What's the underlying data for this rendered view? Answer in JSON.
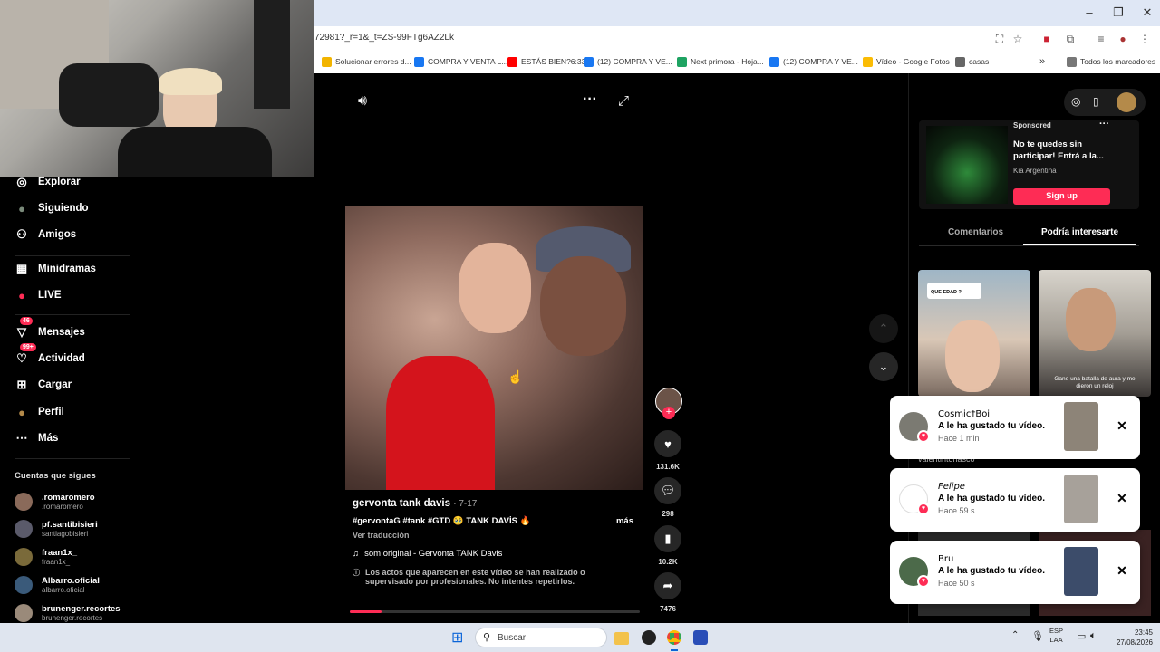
{
  "browser": {
    "url": "72981?_r=1&_t=ZS-99FTg6AZ2Lk",
    "window_buttons": [
      "–",
      "❐",
      "✕"
    ],
    "bookmarks": [
      {
        "label": "Solucionar errores d...",
        "color": "#f2b400"
      },
      {
        "label": "COMPRA Y VENTA L...",
        "color": "#1877f2"
      },
      {
        "label": "ESTÁS BIEN?6:33",
        "color": "#ff0000"
      },
      {
        "label": "(12) COMPRA Y VE...",
        "color": "#1877f2"
      },
      {
        "label": "Next primora - Hoja...",
        "color": "#1ea362"
      },
      {
        "label": "(12) COMPRA Y VE...",
        "color": "#1877f2"
      },
      {
        "label": "Vídeo - Google Fotos",
        "color": "#fbbc04"
      },
      {
        "label": "casas",
        "color": "#666666"
      }
    ],
    "all_bookmarks": "Todos los marcadores"
  },
  "sidebar": {
    "nav": [
      {
        "label": "Explorar",
        "icon": "compass-icon",
        "glyph": "◎"
      },
      {
        "label": "Siguiendo",
        "icon": "following-avatar-icon",
        "glyph": "●"
      },
      {
        "label": "Amigos",
        "icon": "friends-icon",
        "glyph": "⚇"
      },
      {
        "label": "Minidramas",
        "icon": "film-icon",
        "glyph": "▦"
      },
      {
        "label": "LIVE",
        "icon": "live-icon",
        "glyph": "●"
      },
      {
        "label": "Mensajes",
        "icon": "messages-icon",
        "glyph": "▽",
        "badge": "46"
      },
      {
        "label": "Actividad",
        "icon": "activity-icon",
        "glyph": "♡",
        "badge": "99+"
      },
      {
        "label": "Cargar",
        "icon": "upload-icon",
        "glyph": "⊞"
      },
      {
        "label": "Perfil",
        "icon": "profile-avatar-icon",
        "glyph": "●"
      },
      {
        "label": "Más",
        "icon": "more-icon",
        "glyph": "⋯"
      }
    ],
    "following_heading": "Cuentas que sigues",
    "following": [
      {
        "name": ".romaromero",
        "handle": ".romaromero"
      },
      {
        "name": "pf.santibisieri",
        "handle": "santiagobisieri"
      },
      {
        "name": "fraan1x_",
        "handle": "fraan1x_"
      },
      {
        "name": "Albarro.oficial",
        "handle": "albarro.oficial"
      },
      {
        "name": "brunenger.recortes",
        "handle": "brunenger.recortes"
      }
    ]
  },
  "video": {
    "author": "gervonta tank davis",
    "date": "· 7-17",
    "caption": "#gervontaG #tank #GTD 🥹 TANK DAVİS 🔥",
    "more": "más",
    "translate": "Ver traducción",
    "sound": "som original - Gervonta TANK Davis",
    "disclaimer": "Los actos que aparecen en este vídeo se han realizado o supervisado por profesionales. No intentes repetirlos.",
    "likes": "131.6K",
    "comments": "298",
    "saves": "10.2K",
    "shares": "7476",
    "progress": 0.11
  },
  "right_panel": {
    "ad": {
      "label": "Sponsored",
      "title": "No te quedes sin participar! Entrá a la...",
      "advertiser": "Kia Argentina",
      "cta": "Sign up"
    },
    "tabs": [
      "Comentarios",
      "Podría interesarte"
    ],
    "thumb_texts": [
      "QUE EDAD ?",
      "Gane una batalla de aura y me dieron un reloj"
    ],
    "behind_text": "valentintonasco"
  },
  "notifications": [
    {
      "user": "Cosmic†Boi",
      "text": "A le ha gustado tu vídeo.",
      "time": "Hace 1 min"
    },
    {
      "user": "Felipe",
      "text": "A le ha gustado tu vídeo.",
      "time": "Hace 59 s"
    },
    {
      "user": "Bru",
      "text": "A le ha gustado tu vídeo.",
      "time": "Hace 50 s"
    }
  ],
  "taskbar": {
    "search": "Buscar",
    "lang": "ESP",
    "lang2": "LAA",
    "time": "23:45",
    "date": "27/08/2026"
  }
}
